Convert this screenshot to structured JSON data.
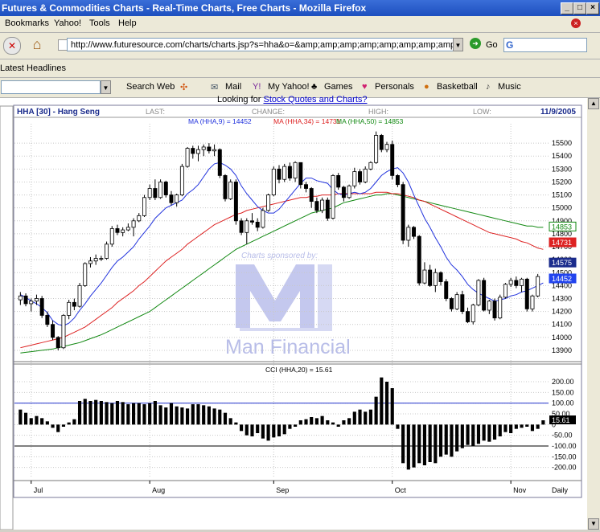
{
  "window": {
    "title": "Futures & Commodities Charts - Real-Time Charts, Free Charts - Mozilla Firefox",
    "minimize": "_",
    "maximize": "□",
    "close": "×"
  },
  "menu": {
    "items": [
      "Bookmarks",
      "Yahoo!",
      "Tools",
      "Help"
    ],
    "close_tab": "×"
  },
  "nav": {
    "url": "http://www.futuresource.com/charts/charts.jsp?s=hha&o=&amp;amp;amp;amp;amp;amp;amp;amp;amp;amp;a=D",
    "go_label": "Go",
    "search_engine_letter": "G"
  },
  "bookmarks": {
    "latest_headlines": "Latest Headlines"
  },
  "yahoo_toolbar": {
    "search_web": "Search Web",
    "mail": "Mail",
    "my_yahoo": "My Yahoo!",
    "games": "Games",
    "personals": "Personals",
    "basketball": "Basketball",
    "music": "Music"
  },
  "page": {
    "looking_for": "Looking for",
    "looking_link": "Stock Quotes and Charts?"
  },
  "chart_header": {
    "symbol": "HHA [30] - Hang Seng",
    "last_label": "LAST:",
    "change_label": "CHANGE:",
    "high_label": "HIGH:",
    "low_label": "LOW:",
    "date": "11/9/2005",
    "ma9_label": "MA (HHA,9) = 14452",
    "ma34_label": "MA (HHA,34) = 14731",
    "ma50_label": "MA (HHA,50) = 14853",
    "watermark_top": "Charts sponsored by:",
    "watermark_brand": "Man Financial",
    "cci_label": "CCI (HHA,20) = 15.61",
    "period": "Daily"
  },
  "colors": {
    "ma9": "#2233dd",
    "ma34": "#dd2222",
    "ma50": "#118811",
    "candle": "#000000",
    "grid": "#c8c8c8",
    "label_blue": "#1a2b8c",
    "watermark": "#b8bde8",
    "cci_upper_line": "#2233cc",
    "cci_lower_line": "#000000"
  },
  "chart_data": [
    {
      "type": "candlestick",
      "title": "HHA [30] - Hang Seng",
      "ylim": [
        13850,
        15600
      ],
      "yticks": [
        13900,
        14000,
        14100,
        14200,
        14300,
        14400,
        14500,
        14600,
        14700,
        14800,
        14900,
        15000,
        15100,
        15200,
        15300,
        15400,
        15500
      ],
      "price_flags": [
        {
          "series": "MA 50",
          "value": 14853
        },
        {
          "series": "MA 34",
          "value": 14731
        },
        {
          "series": "Last",
          "value": 14575
        },
        {
          "series": "MA 9",
          "value": 14452
        }
      ],
      "x_labels": [
        {
          "label": "Jul",
          "index": 2
        },
        {
          "label": "Aug",
          "index": 24
        },
        {
          "label": "Sep",
          "index": 47
        },
        {
          "label": "Oct",
          "index": 69
        },
        {
          "label": "Nov",
          "index": 91
        }
      ],
      "candles": [
        [
          14290,
          14350,
          14250,
          14320
        ],
        [
          14320,
          14340,
          14240,
          14260
        ],
        [
          14260,
          14300,
          14200,
          14280
        ],
        [
          14280,
          14330,
          14250,
          14300
        ],
        [
          14300,
          14320,
          14150,
          14170
        ],
        [
          14170,
          14200,
          14080,
          14100
        ],
        [
          14100,
          14130,
          13980,
          14000
        ],
        [
          14000,
          14010,
          13900,
          13920
        ],
        [
          13920,
          14180,
          13910,
          14170
        ],
        [
          14170,
          14290,
          14140,
          14270
        ],
        [
          14270,
          14300,
          14210,
          14240
        ],
        [
          14240,
          14420,
          14230,
          14400
        ],
        [
          14400,
          14580,
          14390,
          14570
        ],
        [
          14570,
          14620,
          14540,
          14590
        ],
        [
          14590,
          14640,
          14560,
          14610
        ],
        [
          14610,
          14630,
          14590,
          14610
        ],
        [
          14610,
          14740,
          14600,
          14720
        ],
        [
          14720,
          14860,
          14700,
          14840
        ],
        [
          14840,
          14870,
          14790,
          14810
        ],
        [
          14810,
          14850,
          14780,
          14830
        ],
        [
          14830,
          14880,
          14820,
          14850
        ],
        [
          14850,
          14920,
          14780,
          14900
        ],
        [
          14900,
          14960,
          14890,
          14940
        ],
        [
          14940,
          15100,
          14930,
          15080
        ],
        [
          15080,
          15180,
          15060,
          15150
        ],
        [
          15150,
          15220,
          15060,
          15080
        ],
        [
          15080,
          15220,
          15070,
          15200
        ],
        [
          15200,
          15210,
          15080,
          15100
        ],
        [
          15100,
          15130,
          15020,
          15040
        ],
        [
          15040,
          15110,
          15010,
          15100
        ],
        [
          15100,
          15340,
          15090,
          15320
        ],
        [
          15320,
          15470,
          15310,
          15460
        ],
        [
          15460,
          15480,
          15380,
          15420
        ],
        [
          15420,
          15480,
          15360,
          15450
        ],
        [
          15450,
          15490,
          15400,
          15470
        ],
        [
          15470,
          15500,
          15420,
          15440
        ],
        [
          15440,
          15490,
          15400,
          15450
        ],
        [
          15450,
          15460,
          15230,
          15250
        ],
        [
          15250,
          15260,
          15050,
          15070
        ],
        [
          15070,
          15220,
          15060,
          15200
        ],
        [
          15200,
          15220,
          14870,
          14900
        ],
        [
          14900,
          14920,
          14790,
          14810
        ],
        [
          14810,
          14920,
          14720,
          14900
        ],
        [
          14900,
          14960,
          14870,
          14890
        ],
        [
          14890,
          14920,
          14820,
          14850
        ],
        [
          14850,
          15000,
          14840,
          14980
        ],
        [
          14980,
          15110,
          14970,
          15100
        ],
        [
          15100,
          15320,
          15090,
          15300
        ],
        [
          15300,
          15330,
          15190,
          15220
        ],
        [
          15220,
          15340,
          15200,
          15320
        ],
        [
          15320,
          15350,
          15210,
          15230
        ],
        [
          15230,
          15360,
          15200,
          15350
        ],
        [
          15350,
          15330,
          15150,
          15180
        ],
        [
          15180,
          15200,
          15120,
          15150
        ],
        [
          15150,
          15160,
          15000,
          15050
        ],
        [
          15050,
          15080,
          14960,
          14980
        ],
        [
          14980,
          15080,
          14960,
          15060
        ],
        [
          15060,
          15080,
          14900,
          14920
        ],
        [
          14920,
          15260,
          14910,
          15250
        ],
        [
          15250,
          15270,
          15140,
          15160
        ],
        [
          15160,
          15170,
          15050,
          15080
        ],
        [
          15080,
          15180,
          15070,
          15170
        ],
        [
          15170,
          15310,
          15150,
          15280
        ],
        [
          15280,
          15300,
          15180,
          15200
        ],
        [
          15200,
          15320,
          15190,
          15300
        ],
        [
          15300,
          15360,
          15290,
          15350
        ],
        [
          15350,
          15590,
          15340,
          15560
        ],
        [
          15560,
          15570,
          15430,
          15450
        ],
        [
          15450,
          15510,
          15430,
          15490
        ],
        [
          15490,
          15520,
          15220,
          15250
        ],
        [
          15250,
          15260,
          15160,
          15180
        ],
        [
          15180,
          15200,
          14720,
          14750
        ],
        [
          14750,
          14870,
          14700,
          14850
        ],
        [
          14850,
          14860,
          14760,
          14780
        ],
        [
          14780,
          14790,
          14400,
          14420
        ],
        [
          14420,
          14580,
          14410,
          14520
        ],
        [
          14520,
          14560,
          14390,
          14400
        ],
        [
          14400,
          14530,
          14350,
          14500
        ],
        [
          14500,
          14510,
          14400,
          14430
        ],
        [
          14430,
          14450,
          14280,
          14300
        ],
        [
          14300,
          14310,
          14200,
          14220
        ],
        [
          14220,
          14350,
          14210,
          14330
        ],
        [
          14330,
          14360,
          14180,
          14200
        ],
        [
          14200,
          14230,
          14110,
          14120
        ],
        [
          14120,
          14260,
          14100,
          14250
        ],
        [
          14250,
          14450,
          14240,
          14440
        ],
        [
          14440,
          14460,
          14200,
          14210
        ],
        [
          14210,
          14290,
          14180,
          14280
        ],
        [
          14280,
          14300,
          14130,
          14150
        ],
        [
          14150,
          14330,
          14140,
          14310
        ],
        [
          14310,
          14420,
          14300,
          14410
        ],
        [
          14410,
          14460,
          14390,
          14440
        ],
        [
          14440,
          14470,
          14380,
          14400
        ],
        [
          14400,
          14460,
          14350,
          14450
        ],
        [
          14450,
          14460,
          14200,
          14220
        ],
        [
          14220,
          14330,
          14200,
          14320
        ],
        [
          14320,
          14490,
          14310,
          14470
        ]
      ],
      "ma9": [
        14330,
        14310,
        14280,
        14260,
        14230,
        14190,
        14130,
        14100,
        14090,
        14110,
        14150,
        14210,
        14260,
        14320,
        14370,
        14420,
        14480,
        14540,
        14590,
        14620,
        14660,
        14700,
        14760,
        14810,
        14860,
        14920,
        14960,
        15000,
        15020,
        15040,
        15060,
        15110,
        15140,
        15180,
        15240,
        15300,
        15340,
        15350,
        15330,
        15300,
        15250,
        15170,
        15110,
        15060,
        15010,
        14980,
        14960,
        14960,
        14990,
        15040,
        15090,
        15140,
        15190,
        15230,
        15230,
        15210,
        15200,
        15190,
        15140,
        15110,
        15100,
        15110,
        15120,
        15110,
        15120,
        15150,
        15200,
        15250,
        15280,
        15300,
        15310,
        15270,
        15200,
        15100,
        15010,
        14920,
        14850,
        14770,
        14700,
        14620,
        14560,
        14520,
        14470,
        14410,
        14370,
        14340,
        14320,
        14300,
        14280,
        14290,
        14300,
        14320,
        14330,
        14350,
        14360,
        14380,
        14400,
        14420
      ],
      "ma34": [
        13920,
        13930,
        13940,
        13950,
        13960,
        13970,
        13980,
        13990,
        14000,
        14020,
        14040,
        14060,
        14080,
        14110,
        14140,
        14170,
        14200,
        14230,
        14270,
        14300,
        14330,
        14360,
        14400,
        14430,
        14470,
        14510,
        14550,
        14590,
        14620,
        14650,
        14680,
        14720,
        14750,
        14780,
        14810,
        14840,
        14870,
        14890,
        14910,
        14930,
        14950,
        14960,
        14980,
        14990,
        15000,
        15010,
        15020,
        15030,
        15040,
        15050,
        15060,
        15070,
        15080,
        15080,
        15090,
        15090,
        15100,
        15100,
        15100,
        15110,
        15110,
        15110,
        15110,
        15110,
        15110,
        15110,
        15120,
        15120,
        15120,
        15110,
        15110,
        15100,
        15090,
        15080,
        15060,
        15050,
        15030,
        15010,
        14990,
        14970,
        14950,
        14930,
        14910,
        14890,
        14870,
        14850,
        14830,
        14810,
        14800,
        14790,
        14780,
        14770,
        14760,
        14740,
        14730,
        14710,
        14690,
        14680
      ],
      "ma50": [
        13880,
        13885,
        13890,
        13895,
        13900,
        13905,
        13910,
        13920,
        13930,
        13940,
        13950,
        13960,
        13975,
        13990,
        14005,
        14020,
        14040,
        14060,
        14080,
        14100,
        14120,
        14140,
        14160,
        14180,
        14200,
        14230,
        14260,
        14290,
        14320,
        14350,
        14380,
        14410,
        14440,
        14470,
        14500,
        14530,
        14560,
        14590,
        14620,
        14650,
        14680,
        14700,
        14720,
        14740,
        14760,
        14780,
        14800,
        14820,
        14840,
        14860,
        14880,
        14900,
        14920,
        14940,
        14960,
        14970,
        14980,
        14990,
        15000,
        15020,
        15040,
        15050,
        15060,
        15070,
        15080,
        15090,
        15100,
        15100,
        15110,
        15110,
        15100,
        15090,
        15080,
        15070,
        15060,
        15050,
        15040,
        15030,
        15020,
        15010,
        15000,
        14990,
        14980,
        14970,
        14960,
        14950,
        14940,
        14930,
        14920,
        14910,
        14900,
        14890,
        14880,
        14870,
        14860,
        14860,
        14850,
        14850
      ]
    },
    {
      "type": "bar",
      "title": "CCI (HHA,20) = 15.61",
      "ylim": [
        -250,
        230
      ],
      "yticks": [
        200,
        150,
        100,
        50,
        0,
        -50,
        -100,
        -150,
        -200
      ],
      "ytick_labels": [
        "200.00",
        "150.00",
        "100.00",
        "50.00",
        "0",
        "-50.00",
        "-100.00",
        "-150.00",
        "-200.00"
      ],
      "reference_lines": [
        100,
        -100
      ],
      "last_value_label": "15.61",
      "values": [
        70,
        55,
        30,
        40,
        30,
        15,
        -15,
        -35,
        -10,
        10,
        25,
        110,
        120,
        110,
        115,
        110,
        105,
        100,
        110,
        105,
        95,
        100,
        100,
        95,
        100,
        110,
        90,
        80,
        100,
        85,
        80,
        75,
        95,
        95,
        90,
        85,
        75,
        70,
        55,
        30,
        10,
        -30,
        -50,
        -55,
        -40,
        -65,
        -75,
        -60,
        -55,
        -45,
        -20,
        -10,
        20,
        25,
        35,
        30,
        40,
        20,
        10,
        -10,
        20,
        30,
        60,
        70,
        60,
        70,
        130,
        220,
        200,
        170,
        -20,
        -180,
        -210,
        -200,
        -180,
        -190,
        -175,
        -180,
        -150,
        -140,
        -150,
        -125,
        -110,
        -95,
        -100,
        -90,
        -75,
        -80,
        -70,
        -55,
        -35,
        -40,
        -20,
        -15,
        -10,
        -30,
        -20,
        20
      ]
    }
  ]
}
